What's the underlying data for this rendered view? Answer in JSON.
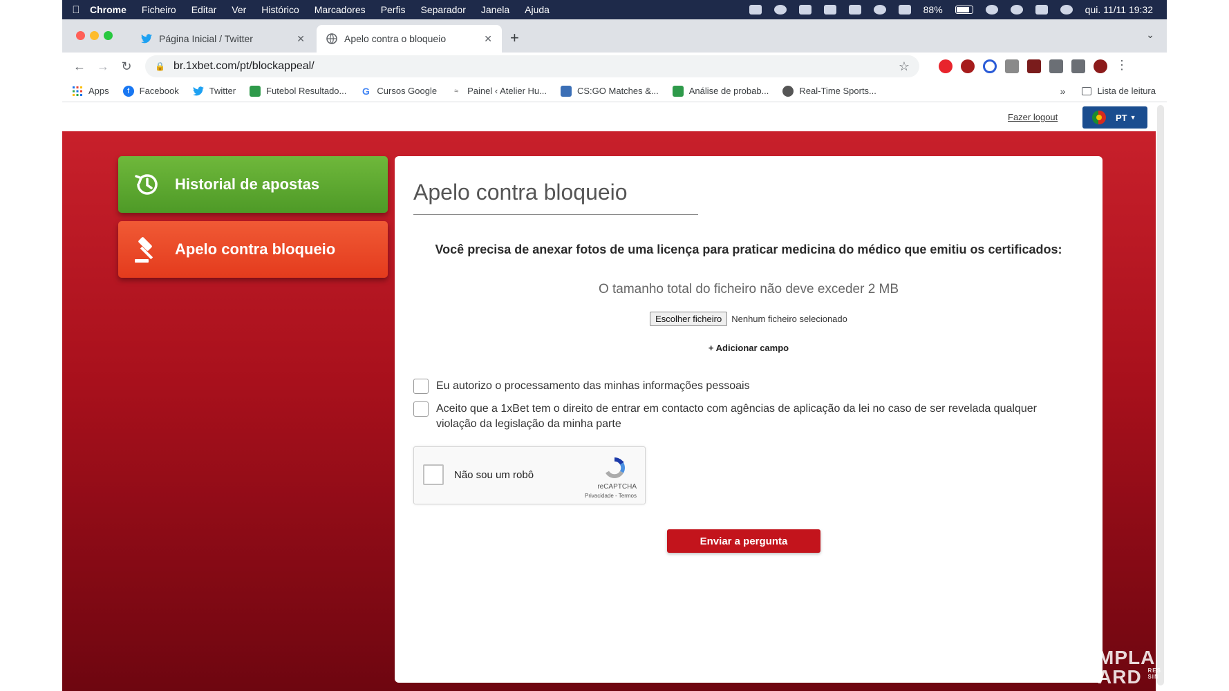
{
  "menubar": {
    "app": "Chrome",
    "items": [
      "Ficheiro",
      "Editar",
      "Ver",
      "Histórico",
      "Marcadores",
      "Perfis",
      "Separador",
      "Janela",
      "Ajuda"
    ],
    "battery": "88%",
    "datetime": "qui. 11/11  19:32"
  },
  "tabs": [
    {
      "title": "Página Inicial / Twitter",
      "icon": "twitter-icon"
    },
    {
      "title": "Apelo contra o bloqueio",
      "icon": "globe-icon"
    }
  ],
  "toolbar": {
    "url": "br.1xbet.com/pt/blockappeal/"
  },
  "bookmarks": {
    "items": [
      {
        "label": "Apps",
        "icon": "apps-grid-icon"
      },
      {
        "label": "Facebook",
        "icon": "facebook-icon"
      },
      {
        "label": "Twitter",
        "icon": "twitter-icon"
      },
      {
        "label": "Futebol Resultado...",
        "icon": "sheet-icon"
      },
      {
        "label": "Cursos Google",
        "icon": "google-icon"
      },
      {
        "label": "Painel ‹ Atelier Hu...",
        "icon": "wp-icon"
      },
      {
        "label": "CS:GO Matches &...",
        "icon": "image-icon"
      },
      {
        "label": "Análise de probab...",
        "icon": "sheet-icon"
      },
      {
        "label": "Real-Time Sports...",
        "icon": "ball-icon"
      }
    ],
    "more": "»",
    "reading_list": "Lista de leitura"
  },
  "site": {
    "logout": "Fazer logout",
    "lang": "PT",
    "menu": {
      "history": "Historial de apostas",
      "appeal": "Apelo contra bloqueio"
    },
    "form": {
      "title": "Apelo contra bloqueio",
      "instruction": "Você precisa de anexar fotos de uma licença para praticar medicina do médico que emitiu os certificados:",
      "size_note": "O tamanho total do ficheiro não deve exceder 2 MB",
      "file_button": "Escolher ficheiro",
      "file_status": "Nenhum ficheiro selecionado",
      "add_field": "+ Adicionar campo",
      "consent1": "Eu autorizo o processamento das minhas informações pessoais",
      "consent2_line1": "Aceito que a 1xBet tem o direito de entrar em contacto com agências de aplicação da lei no caso de ser revelada qualquer",
      "consent2_line2": "violação da legislação da minha parte",
      "captcha_label": "Não sou um robô",
      "captcha_brand": "reCAPTCHA",
      "captcha_terms": "Privacidade - Termos",
      "submit": "Enviar a pergunta"
    }
  },
  "watermark": {
    "line1": "MPLA",
    "line2": "ARD",
    "small1": "RES",
    "small2": "SIN"
  },
  "colors": {
    "menubar": "#1e2a4a",
    "site_red": "#c8202b",
    "green_button": "#5fa833",
    "orange_button": "#e9452a",
    "submit_red": "#c3141c",
    "lang_blue": "#1a4d8f"
  }
}
